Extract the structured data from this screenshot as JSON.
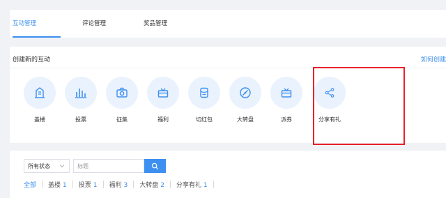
{
  "tabs": [
    {
      "label": "互动管理",
      "active": true
    },
    {
      "label": "评论管理",
      "active": false
    },
    {
      "label": "奖品管理",
      "active": false
    }
  ],
  "create_section": {
    "title": "创建新的互动",
    "help_link": "如何创建"
  },
  "interaction_types": [
    {
      "label": "盖楼",
      "icon": "building-icon"
    },
    {
      "label": "投票",
      "icon": "bar-chart-icon"
    },
    {
      "label": "征集",
      "icon": "camera-icon"
    },
    {
      "label": "福利",
      "icon": "gift-icon"
    },
    {
      "label": "切红包",
      "icon": "red-packet-icon"
    },
    {
      "label": "大转盘",
      "icon": "wheel-icon"
    },
    {
      "label": "派券",
      "icon": "coupon-icon"
    },
    {
      "label": "分享有礼",
      "icon": "share-icon"
    }
  ],
  "filter_bar": {
    "status_select": "所有状态",
    "search_placeholder": "标题"
  },
  "type_filters": [
    {
      "label": "全部",
      "count": "",
      "active": true
    },
    {
      "label": "盖楼",
      "count": "1",
      "active": false
    },
    {
      "label": "投票",
      "count": "1",
      "active": false
    },
    {
      "label": "福利",
      "count": "3",
      "active": false
    },
    {
      "label": "大转盘",
      "count": "2",
      "active": false
    },
    {
      "label": "分享有礼",
      "count": "1",
      "active": false
    }
  ],
  "colors": {
    "accent": "#3d8ff0",
    "highlight_box": "#e8202a"
  }
}
